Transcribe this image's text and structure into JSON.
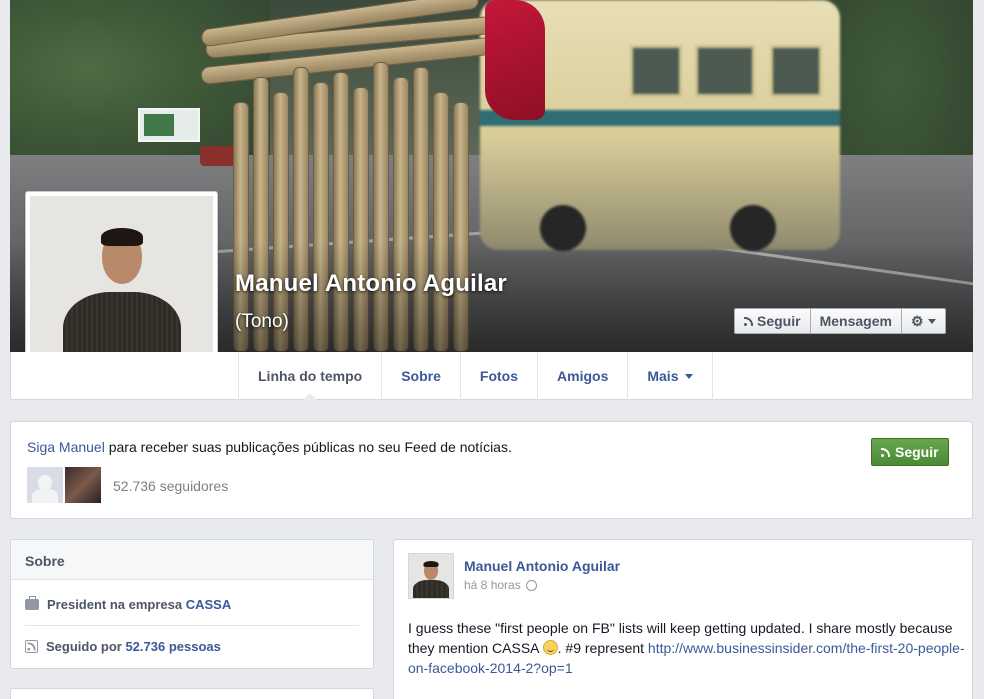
{
  "profile": {
    "name": "Manuel Antonio Aguilar",
    "nickname": "(Tono)"
  },
  "cover_buttons": {
    "follow": "Seguir",
    "message": "Mensagem",
    "settings_icon": "gear-icon"
  },
  "tabs": [
    {
      "label": "Linha do tempo",
      "active": true
    },
    {
      "label": "Sobre"
    },
    {
      "label": "Fotos"
    },
    {
      "label": "Amigos"
    },
    {
      "label": "Mais"
    }
  ],
  "follow_box": {
    "link": "Siga Manuel",
    "text": " para receber suas publicações públicas no seu Feed de notícias.",
    "followers": "52.736 seguidores",
    "button": "Seguir"
  },
  "about": {
    "title": "Sobre",
    "work_prefix": "President na empresa ",
    "work_company": "CASSA",
    "followed_prefix": "Seguido por ",
    "followed_count": "52.736 pessoas"
  },
  "post": {
    "author": "Manuel Antonio Aguilar",
    "time": "há 8 horas",
    "text_before": "I guess these \"first people on FB\" lists will keep getting updated. I share mostly because they mention CASSA ",
    "text_after": ". #9 represent ",
    "link": "http://www.businessinsider.com/the-first-20-people-on-facebook-2014-2?op=1"
  },
  "colors": {
    "link": "#3b5998",
    "page_bg": "#e9eaed",
    "follow_green": "#4a8a36"
  }
}
